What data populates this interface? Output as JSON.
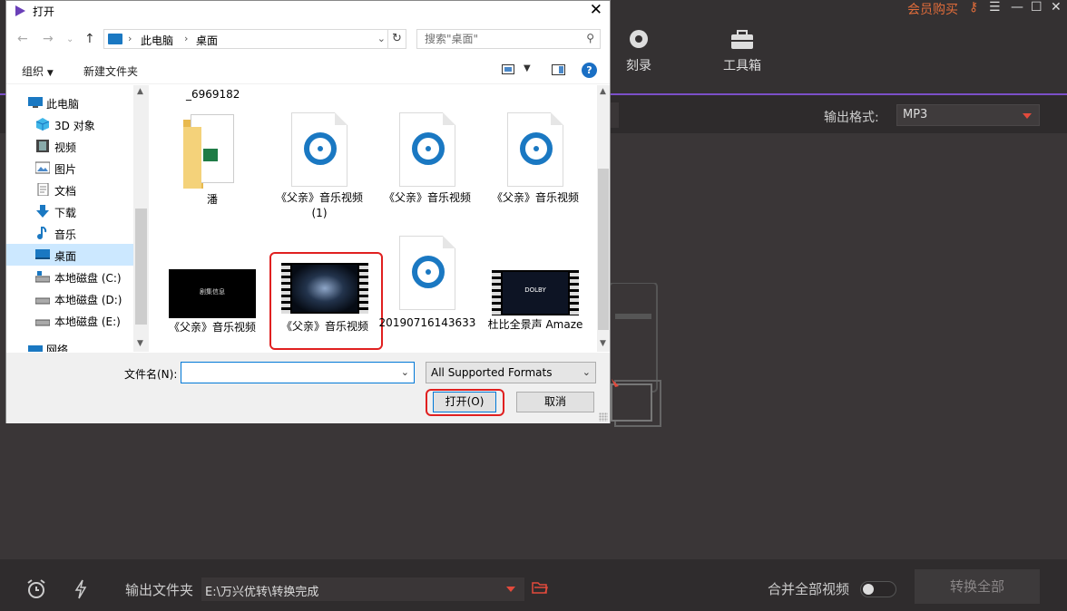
{
  "app": {
    "member_label": "会员购买",
    "nav": [
      {
        "label": "刻录"
      },
      {
        "label": "工具箱"
      }
    ],
    "output_format_label": "输出格式:",
    "output_format_value": "MP3",
    "output_folder_label": "输出文件夹",
    "output_folder_path": "E:\\万兴优转\\转换完成",
    "merge_label": "合并全部视频",
    "convert_all_label": "转换全部",
    "accent_color": "#7b4fc9"
  },
  "dialog": {
    "title": "打开",
    "breadcrumb": [
      "此电脑",
      "桌面"
    ],
    "search_placeholder": "搜索\"桌面\"",
    "toolbar": {
      "organize": "组织",
      "new_folder": "新建文件夹"
    },
    "nav_items": [
      {
        "label": "此电脑",
        "icon": "computer-icon"
      },
      {
        "label": "3D 对象",
        "icon": "3d-objects-icon"
      },
      {
        "label": "视频",
        "icon": "videos-icon"
      },
      {
        "label": "图片",
        "icon": "pictures-icon"
      },
      {
        "label": "文档",
        "icon": "documents-icon"
      },
      {
        "label": "下载",
        "icon": "download-icon"
      },
      {
        "label": "音乐",
        "icon": "music-icon"
      },
      {
        "label": "桌面",
        "icon": "desktop-icon",
        "selected": true
      },
      {
        "label": "本地磁盘 (C:)",
        "icon": "drive-icon"
      },
      {
        "label": "本地磁盘 (D:)",
        "icon": "drive-icon"
      },
      {
        "label": "本地磁盘 (E:)",
        "icon": "drive-icon"
      },
      {
        "label": "网络",
        "icon": "network-icon"
      }
    ],
    "partial_file_label": "_6969182",
    "files": [
      {
        "name": "潘",
        "type": "folder"
      },
      {
        "name": "《父亲》音乐视频(1)",
        "type": "audio"
      },
      {
        "name": "《父亲》音乐视频",
        "type": "audio"
      },
      {
        "name": "《父亲》音乐视频",
        "type": "audio"
      },
      {
        "name": "《父亲》音乐视频",
        "type": "video",
        "thumb_text": "剧集信息"
      },
      {
        "name": "《父亲》音乐视频",
        "type": "video-film",
        "selected": true
      },
      {
        "name": "20190716143633",
        "type": "audio"
      },
      {
        "name": "杜比全景声 Amaze",
        "type": "video-film",
        "thumb_text": "DOLBY"
      }
    ],
    "filename_label": "文件名(N):",
    "filename_value": "",
    "filter_value": "All Supported Formats",
    "open_label": "打开(O)",
    "cancel_label": "取消",
    "highlight_color": "#e02020"
  }
}
